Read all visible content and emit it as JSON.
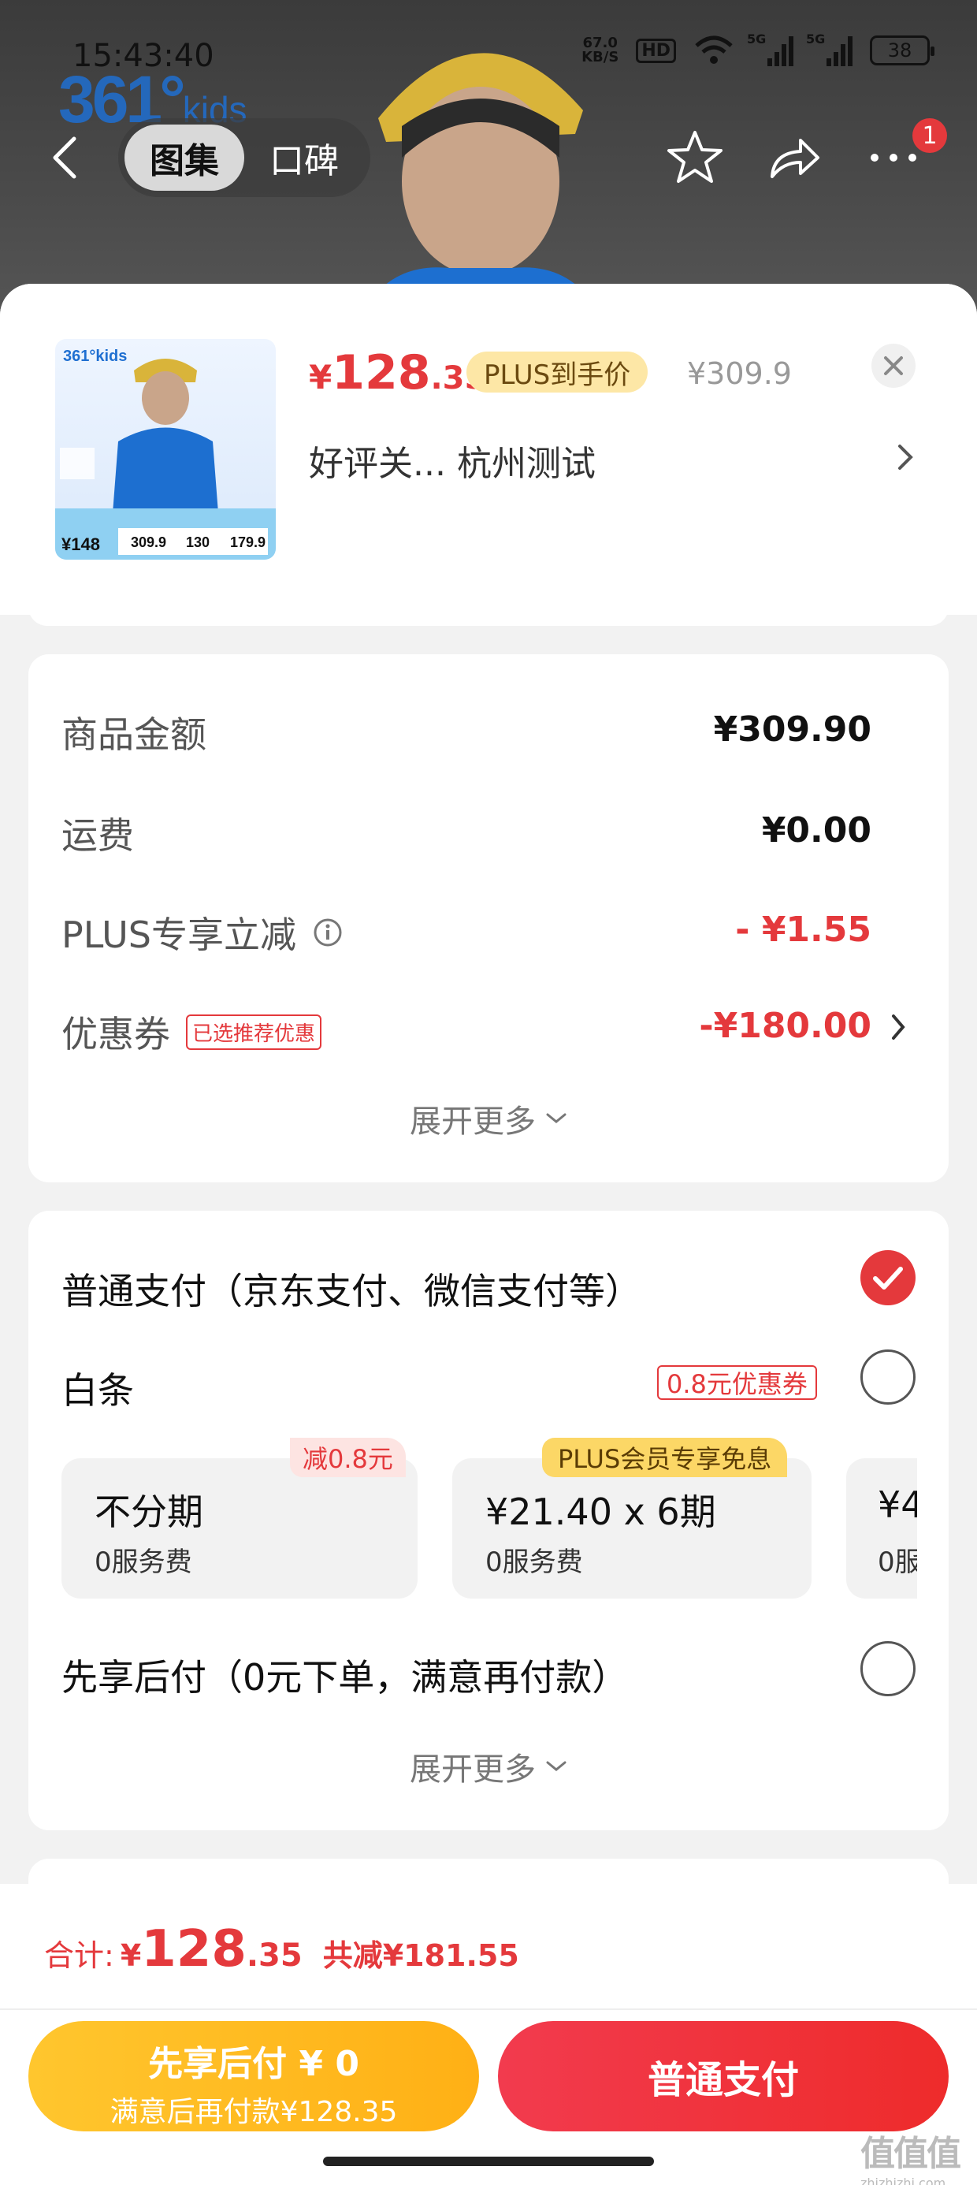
{
  "status_bar": {
    "time": "15:43:40",
    "net_speed_value": "67.0",
    "net_speed_unit": "KB/S",
    "hd_label": "HD",
    "sim1_label": "5G",
    "sim2_label": "5G",
    "battery": "38"
  },
  "header": {
    "brand_logo_text": "361°",
    "brand_logo_sub": "kids",
    "tabs": [
      {
        "label": "图集",
        "active": true
      },
      {
        "label": "口碑",
        "active": false
      }
    ],
    "notification_count": "1",
    "icons": [
      "back-icon",
      "star-icon",
      "share-icon",
      "more-icon"
    ]
  },
  "product": {
    "price_currency": "¥",
    "price_integer": "128",
    "price_decimal": ".35",
    "plus_tag": "PLUS到手价",
    "original_price": "¥309.9",
    "spec_text": "好评关...  杭州测试",
    "thumb_promo_price": "148",
    "thumb_prices": [
      "309.9",
      "130",
      "179.9"
    ]
  },
  "fees": {
    "rows": [
      {
        "label": "商品金额",
        "value": "¥309.90"
      },
      {
        "label": "运费",
        "value": "¥0.00"
      },
      {
        "label": "PLUS专享立减",
        "value": "- ¥1.55"
      },
      {
        "label": "优惠券",
        "note": "已选推荐优惠",
        "value": "-¥180.00"
      }
    ],
    "expand_label": "展开更多"
  },
  "payment": {
    "normal_label": "普通支付（京东支付、微信支付等）",
    "normal_checked": true,
    "baitiao_label": "白条",
    "baitiao_coupon": "0.8元优惠券",
    "plans": [
      {
        "title": "不分期",
        "fee": "0服务费",
        "tag": "减0.8元"
      },
      {
        "title": "¥21.40 x 6期",
        "fee": "0服务费",
        "tag": "PLUS会员专享免息"
      },
      {
        "title": "¥4",
        "fee": "0服",
        "tag": ""
      }
    ],
    "later_label": "先享后付（0元下单，满意再付款）",
    "expand_label": "展开更多"
  },
  "footer": {
    "total_label": "合计:",
    "total_currency": "¥",
    "total_integer": "128",
    "total_decimal": ".35",
    "saved_text": "共减¥181.55",
    "btn_later_line1": "先享后付 ¥ 0",
    "btn_later_line2": "满意后再付款¥128.35",
    "btn_normal": "普通支付"
  },
  "watermark": {
    "text": "值值值",
    "sub": "zhizhizhi.com"
  },
  "colors": {
    "accent_red": "#e4393c",
    "plus_gold": "#fcd766",
    "later_yellow": "#ffb015"
  }
}
